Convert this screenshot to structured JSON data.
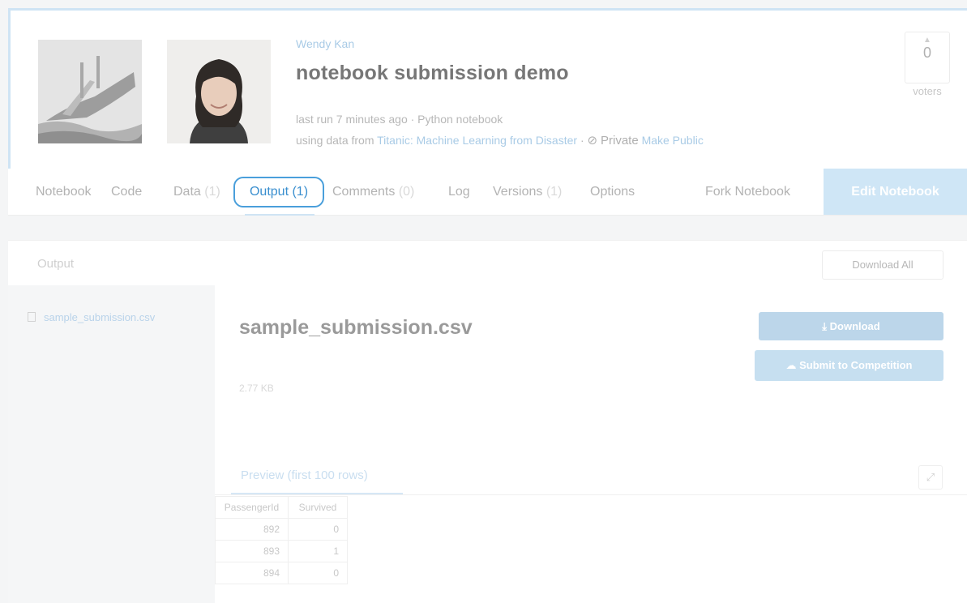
{
  "header": {
    "author": "Wendy Kan",
    "title": "notebook submission demo",
    "meta_line1": "last run 7 minutes ago · Python notebook",
    "meta_prefix": "using data from",
    "dataset_link": "Titanic: Machine Learning from Disaster",
    "sep": "·",
    "privacy_icon": "eye-slash-icon",
    "privacy": "Private",
    "make_public": "Make Public",
    "votes": {
      "count": "0",
      "label": "voters"
    }
  },
  "tabs": [
    {
      "label": "Notebook",
      "count": ""
    },
    {
      "label": "Code",
      "count": ""
    },
    {
      "label": "Data",
      "count": "(1)"
    },
    {
      "label": "Output (1)",
      "count": "",
      "active": true
    },
    {
      "label": "Comments",
      "count": "(0)"
    },
    {
      "label": "Log",
      "count": ""
    },
    {
      "label": "Versions",
      "count": "(1)"
    },
    {
      "label": "Options",
      "count": ""
    }
  ],
  "fork_label": "Fork Notebook",
  "edit_label": "Edit Notebook",
  "output": {
    "section_label": "Output",
    "download_all": "Download All",
    "files": [
      {
        "name": "sample_submission.csv"
      }
    ],
    "selected": {
      "name": "sample_submission.csv",
      "size": "2.77 KB",
      "download_label": "Download",
      "submit_label": "Submit to Competition",
      "preview_label": "Preview (first 100 rows)",
      "expand_icon": "expand-icon"
    },
    "table": {
      "columns": [
        "PassengerId",
        "Survived"
      ],
      "rows": [
        [
          "892",
          "0"
        ],
        [
          "893",
          "1"
        ],
        [
          "894",
          "0"
        ]
      ]
    }
  },
  "colors": {
    "accent": "#4a9fdb",
    "link": "#a9cbe6",
    "button": "#bcd6ea"
  }
}
